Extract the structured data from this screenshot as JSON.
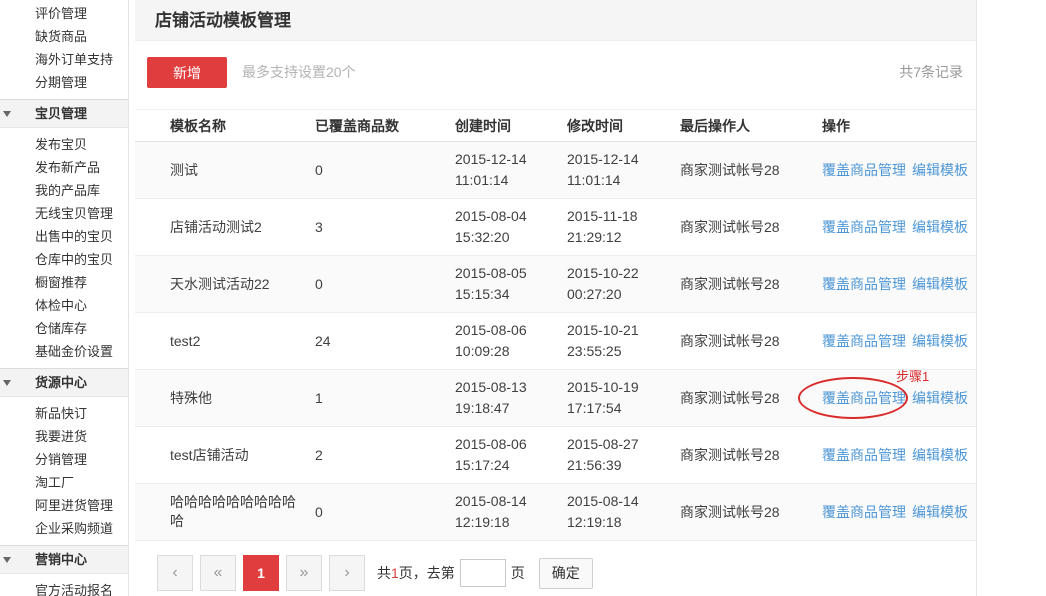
{
  "page": {
    "title": "店铺活动模板管理"
  },
  "sidebar": {
    "items": [
      {
        "label": "评价管理",
        "type": "item"
      },
      {
        "label": "缺货商品",
        "type": "item"
      },
      {
        "label": "海外订单支持",
        "type": "item"
      },
      {
        "label": "分期管理",
        "type": "item"
      },
      {
        "label": "宝贝管理",
        "type": "section"
      },
      {
        "label": "发布宝贝",
        "type": "item"
      },
      {
        "label": "发布新产品",
        "type": "item"
      },
      {
        "label": "我的产品库",
        "type": "item"
      },
      {
        "label": "无线宝贝管理",
        "type": "item"
      },
      {
        "label": "出售中的宝贝",
        "type": "item"
      },
      {
        "label": "仓库中的宝贝",
        "type": "item"
      },
      {
        "label": "橱窗推荐",
        "type": "item"
      },
      {
        "label": "体检中心",
        "type": "item"
      },
      {
        "label": "仓储库存",
        "type": "item"
      },
      {
        "label": "基础金价设置",
        "type": "item"
      },
      {
        "label": "货源中心",
        "type": "section"
      },
      {
        "label": "新品快订",
        "type": "item"
      },
      {
        "label": "我要进货",
        "type": "item"
      },
      {
        "label": "分销管理",
        "type": "item"
      },
      {
        "label": "淘工厂",
        "type": "item"
      },
      {
        "label": "阿里进货管理",
        "type": "item"
      },
      {
        "label": "企业采购频道",
        "type": "item"
      },
      {
        "label": "营销中心",
        "type": "section"
      },
      {
        "label": "官方活动报名",
        "type": "item"
      }
    ]
  },
  "toolbar": {
    "add_button": "新增",
    "hint": "最多支持设置20个",
    "record_count": "共7条记录"
  },
  "table": {
    "columns": [
      "模板名称",
      "已覆盖商品数",
      "创建时间",
      "修改时间",
      "最后操作人",
      "操作"
    ],
    "ops": {
      "manage": "覆盖商品管理",
      "edit": "编辑模板"
    },
    "rows": [
      {
        "name": "测试",
        "count": "0",
        "created_date": "2015-12-14",
        "created_time": "11:01:14",
        "modified_date": "2015-12-14",
        "modified_time": "11:01:14",
        "operator": "商家测试帐号28"
      },
      {
        "name": "店铺活动测试2",
        "count": "3",
        "created_date": "2015-08-04",
        "created_time": "15:32:20",
        "modified_date": "2015-11-18",
        "modified_time": "21:29:12",
        "operator": "商家测试帐号28"
      },
      {
        "name": "天水测试活动22",
        "count": "0",
        "created_date": "2015-08-05",
        "created_time": "15:15:34",
        "modified_date": "2015-10-22",
        "modified_time": "00:27:20",
        "operator": "商家测试帐号28"
      },
      {
        "name": "test2",
        "count": "24",
        "created_date": "2015-08-06",
        "created_time": "10:09:28",
        "modified_date": "2015-10-21",
        "modified_time": "23:55:25",
        "operator": "商家测试帐号28"
      },
      {
        "name": "特殊他",
        "count": "1",
        "created_date": "2015-08-13",
        "created_time": "19:18:47",
        "modified_date": "2015-10-19",
        "modified_time": "17:17:54",
        "operator": "商家测试帐号28"
      },
      {
        "name": "test店铺活动",
        "count": "2",
        "created_date": "2015-08-06",
        "created_time": "15:17:24",
        "modified_date": "2015-08-27",
        "modified_time": "21:56:39",
        "operator": "商家测试帐号28"
      },
      {
        "name": "哈哈哈哈哈哈哈哈哈哈",
        "count": "0",
        "created_date": "2015-08-14",
        "created_time": "12:19:18",
        "modified_date": "2015-08-14",
        "modified_time": "12:19:18",
        "operator": "商家测试帐号28"
      }
    ]
  },
  "pagination": {
    "prev": "‹",
    "first": "«",
    "page": "1",
    "last": "»",
    "next": "›",
    "total_prefix": "共",
    "total_pages": "1",
    "total_suffix": "页，去第",
    "goto_suffix": "页",
    "confirm": "确定",
    "goto_value": ""
  },
  "annotation": {
    "step_label": "步骤1"
  },
  "colors": {
    "accent_red": "#df3d3e",
    "link_blue": "#4e97d6",
    "annotation_red": "#d92b2b",
    "band_gray": "#f5f5f5",
    "alt_row_gray": "#fafafa"
  }
}
